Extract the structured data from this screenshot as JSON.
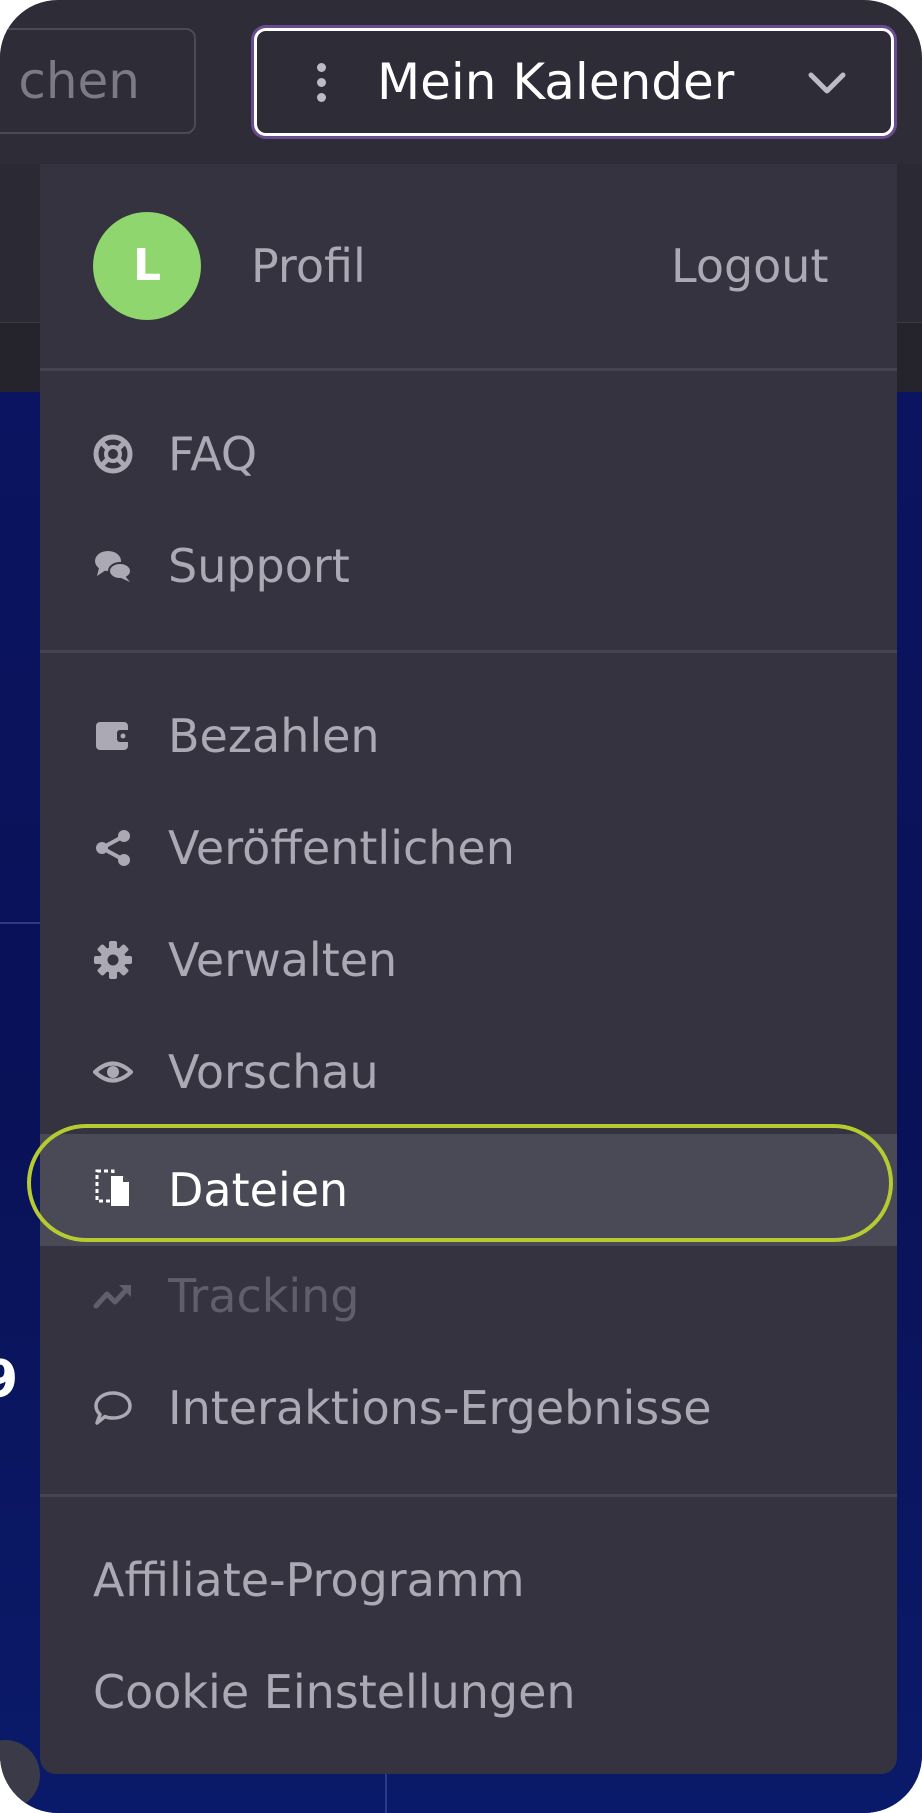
{
  "topbar": {
    "search_text": "chen",
    "calendar_button_label": "Mein Kalender"
  },
  "account": {
    "avatar_initial": "L",
    "profile_label": "Profil",
    "logout_label": "Logout"
  },
  "help_items": [
    {
      "label": "FAQ",
      "icon": "lifebuoy-icon"
    },
    {
      "label": "Support",
      "icon": "chat-bubbles-icon"
    }
  ],
  "calendar_items": [
    {
      "label": "Bezahlen",
      "icon": "wallet-icon"
    },
    {
      "label": "Veröffentlichen",
      "icon": "share-icon"
    },
    {
      "label": "Verwalten",
      "icon": "gear-icon"
    },
    {
      "label": "Vorschau",
      "icon": "eye-icon"
    },
    {
      "label": "Dateien",
      "icon": "files-icon",
      "state": "active"
    },
    {
      "label": "Tracking",
      "icon": "trend-up-icon",
      "state": "disabled"
    },
    {
      "label": "Interaktions-Ergebnisse",
      "icon": "comment-icon"
    }
  ],
  "footer_items": [
    {
      "label": "Affiliate-Programm"
    },
    {
      "label": "Cookie Einstellungen"
    }
  ],
  "colors": {
    "menu_bg": "#34333f",
    "avatar_bg": "#8ed66d",
    "highlight": "#b6cb31",
    "background_canvas": "#0a1460"
  }
}
